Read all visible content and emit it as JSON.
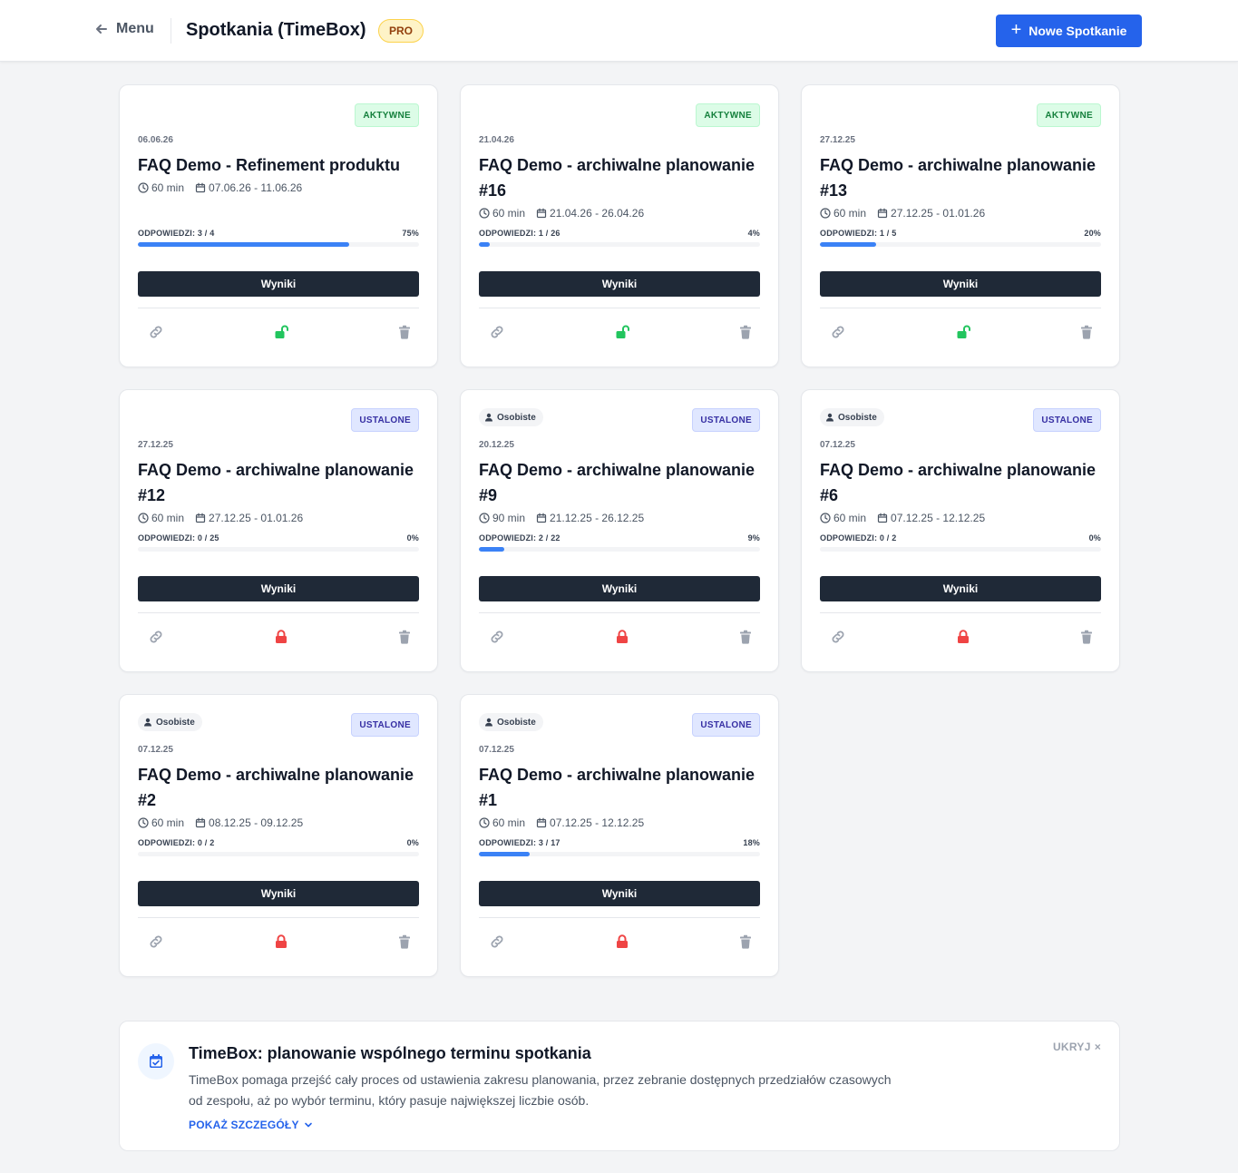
{
  "header": {
    "back_label": "Menu",
    "title": "Spotkania (TimeBox)",
    "badge": "PRO",
    "new_button": "Nowe Spotkanie"
  },
  "colors": {
    "primary": "#2563eb",
    "dark_button": "#1f2937",
    "progress": "#3b82f6",
    "unlocked": "#22c55e",
    "locked": "#ef4444",
    "muted_icon": "#9ca3af"
  },
  "cards": [
    {
      "status": "AKTYWNE",
      "status_type": "active",
      "personal": "",
      "date": "06.06.26",
      "title": "FAQ Demo - Refinement produktu",
      "duration": "60 min",
      "range": "07.06.26 - 11.06.26",
      "responses": "ODPOWIEDZI: 3 / 4",
      "percent": "75%",
      "progress": 0.75,
      "results": "Wyniki",
      "lock_state": "unlocked-icon",
      "lines": 1
    },
    {
      "status": "AKTYWNE",
      "status_type": "active",
      "personal": "",
      "date": "21.04.26",
      "title": "FAQ Demo - archiwalne planowanie #16",
      "duration": "60 min",
      "range": "21.04.26 - 26.04.26",
      "responses": "ODPOWIEDZI: 1 / 26",
      "percent": "4%",
      "progress": 0.04,
      "results": "Wyniki",
      "lock_state": "unlocked-icon",
      "lines": 2
    },
    {
      "status": "AKTYWNE",
      "status_type": "active",
      "personal": "",
      "date": "27.12.25",
      "title": "FAQ Demo - archiwalne planowanie #13",
      "duration": "60 min",
      "range": "27.12.25 - 01.01.26",
      "responses": "ODPOWIEDZI: 1 / 5",
      "percent": "20%",
      "progress": 0.2,
      "results": "Wyniki",
      "lock_state": "unlocked-icon",
      "lines": 2
    },
    {
      "status": "USTALONE",
      "status_type": "set",
      "personal": "",
      "date": "27.12.25",
      "title": "FAQ Demo - archiwalne planowanie #12",
      "duration": "60 min",
      "range": "27.12.25 - 01.01.26",
      "responses": "ODPOWIEDZI: 0 / 25",
      "percent": "0%",
      "progress": 0,
      "results": "Wyniki",
      "lock_state": "locked-icon",
      "lines": 2
    },
    {
      "status": "USTALONE",
      "status_type": "set",
      "personal": "Osobiste",
      "date": "20.12.25",
      "title": "FAQ Demo - archiwalne planowanie #9",
      "duration": "90 min",
      "range": "21.12.25 - 26.12.25",
      "responses": "ODPOWIEDZI: 2 / 22",
      "percent": "9%",
      "progress": 0.09,
      "results": "Wyniki",
      "lock_state": "locked-icon",
      "lines": 2
    },
    {
      "status": "USTALONE",
      "status_type": "set",
      "personal": "Osobiste",
      "date": "07.12.25",
      "title": "FAQ Demo - archiwalne planowanie #6",
      "duration": "60 min",
      "range": "07.12.25 - 12.12.25",
      "responses": "ODPOWIEDZI: 0 / 2",
      "percent": "0%",
      "progress": 0,
      "results": "Wyniki",
      "lock_state": "locked-icon",
      "lines": 2
    },
    {
      "status": "USTALONE",
      "status_type": "set",
      "personal": "Osobiste",
      "date": "07.12.25",
      "title": "FAQ Demo - archiwalne planowanie #2",
      "duration": "60 min",
      "range": "08.12.25 - 09.12.25",
      "responses": "ODPOWIEDZI: 0 / 2",
      "percent": "0%",
      "progress": 0,
      "results": "Wyniki",
      "lock_state": "locked-icon",
      "lines": 2
    },
    {
      "status": "USTALONE",
      "status_type": "set",
      "personal": "Osobiste",
      "date": "07.12.25",
      "title": "FAQ Demo - archiwalne planowanie #1",
      "duration": "60 min",
      "range": "07.12.25 - 12.12.25",
      "responses": "ODPOWIEDZI: 3 / 17",
      "percent": "18%",
      "progress": 0.18,
      "results": "Wyniki",
      "lock_state": "locked-icon",
      "lines": 2
    }
  ],
  "info": {
    "title": "TimeBox: planowanie wspólnego terminu spotkania",
    "text": "TimeBox pomaga przejść cały proces od ustawienia zakresu planowania, przez zebranie dostępnych przedziałów czasowych od zespołu, aż po wybór terminu, który pasuje największej liczbie osób.",
    "more": "POKAŻ SZCZEGÓŁY",
    "hide": "UKRYJ",
    "hide_icon": "×"
  }
}
